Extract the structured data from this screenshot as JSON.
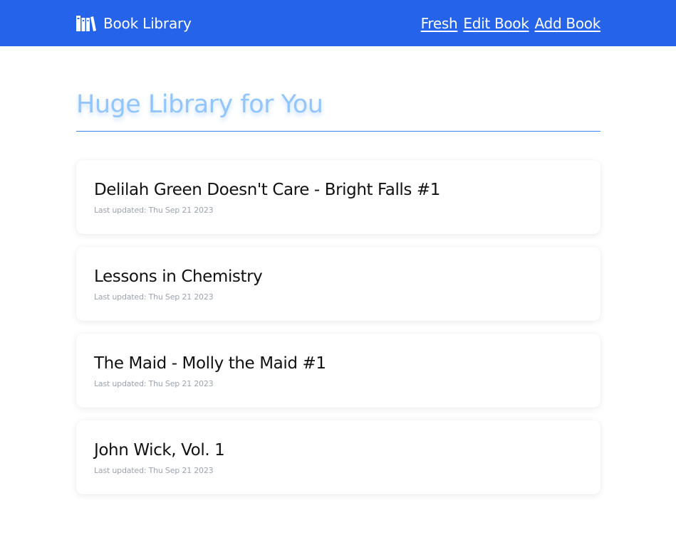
{
  "navbar": {
    "brand_icon": "books-icon",
    "brand_label": "Book Library",
    "links": [
      {
        "label": "Fresh"
      },
      {
        "label": "Edit Book"
      },
      {
        "label": "Add Book"
      }
    ],
    "background": "#2563eb"
  },
  "main": {
    "title": "Huge Library for You",
    "title_color": "#93c5fd",
    "divider_color": "#3b82f6",
    "books": [
      {
        "title": "Delilah Green Doesn't Care - Bright Falls #1",
        "updated": "Last updated: Thu Sep 21 2023"
      },
      {
        "title": "Lessons in Chemistry",
        "updated": "Last updated: Thu Sep 21 2023"
      },
      {
        "title": "The Maid - Molly the Maid #1",
        "updated": "Last updated: Thu Sep 21 2023"
      },
      {
        "title": "John Wick, Vol. 1",
        "updated": "Last updated: Thu Sep 21 2023"
      }
    ]
  }
}
